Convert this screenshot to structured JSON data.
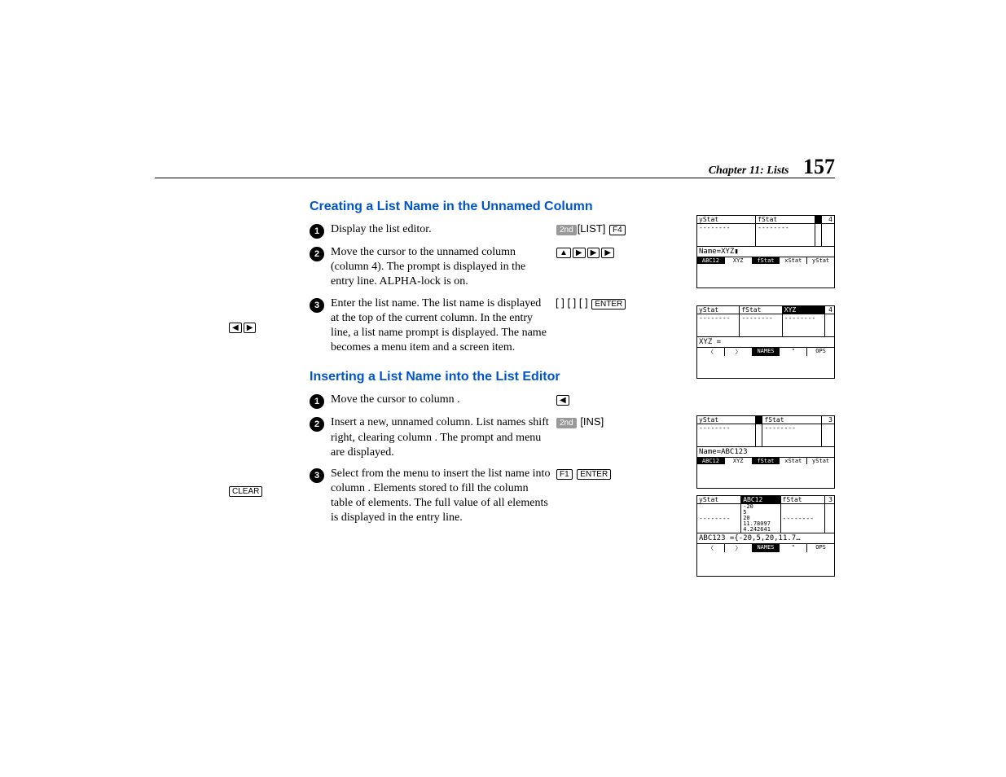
{
  "header": {
    "chapter": "Chapter 11: Lists",
    "page": "157"
  },
  "section_a": {
    "heading": "Creating a List Name in the Unnamed Column",
    "steps": [
      {
        "num": "1",
        "text": "Display the list editor.",
        "keys": [
          {
            "label": "2nd",
            "cls": "gray"
          },
          {
            "label": "[LIST]",
            "cls": "plain"
          },
          {
            "label": "F4",
            "cls": ""
          }
        ]
      },
      {
        "num": "2",
        "text": "Move the cursor to the unnamed column (column 4). The              prompt is displayed in the entry line. ALPHA-lock is on.",
        "keys": [
          {
            "label": "▲",
            "cls": ""
          },
          {
            "label": "▶",
            "cls": ""
          },
          {
            "label": "▶",
            "cls": ""
          },
          {
            "label": "▶",
            "cls": ""
          }
        ]
      },
      {
        "num": "3",
        "text": "Enter the list name. The list name is displayed at the top of the current column. In the entry line, a list name prompt is displayed. The name becomes a                         menu item and a                       screen item.",
        "keys": [
          {
            "label": "[  ] [  ] [  ]",
            "cls": "plain"
          },
          {
            "label": "ENTER",
            "cls": ""
          }
        ]
      }
    ],
    "margin_keys": [
      {
        "label": "◀",
        "cls": ""
      },
      {
        "label": "▶",
        "cls": ""
      }
    ]
  },
  "section_b": {
    "heading": "Inserting a List Name into the List Editor",
    "steps": [
      {
        "num": "1",
        "text": "Move the cursor to column   .",
        "keys": [
          {
            "label": "◀",
            "cls": ""
          }
        ]
      },
      {
        "num": "2",
        "text": "Insert a new, unnamed column. List names shift right, clearing column   . The              prompt and                       menu are displayed.",
        "keys": [
          {
            "label": "2nd",
            "cls": "gray"
          },
          {
            "label": "[INS]",
            "cls": "plain"
          }
        ]
      },
      {
        "num": "3",
        "text": "Select              from the                         menu to insert the list name                   into column   . Elements stored to                   fill the column table of elements. The full value of all elements is displayed in the entry line.",
        "keys": [
          {
            "label": "F1",
            "cls": ""
          },
          {
            "label": "ENTER",
            "cls": ""
          }
        ]
      }
    ],
    "margin_label": "CLEAR"
  },
  "screens": {
    "s1": {
      "cols": [
        "yStat",
        "fStat",
        "",
        "4"
      ],
      "dashes": [
        "--------",
        "--------",
        "",
        ""
      ],
      "name_line": "Name=XYZ▮",
      "footer": [
        "ABC12",
        "XYZ",
        "fStat",
        "xStat",
        "yStat"
      ]
    },
    "s2": {
      "cols": [
        "yStat",
        "fStat",
        "XYZ",
        "4"
      ],
      "dashes": [
        "--------",
        "--------",
        "--------",
        ""
      ],
      "name_line": "XYZ =",
      "footer": [
        "〈",
        "〉",
        "NAMES",
        "\"",
        "OPS"
      ]
    },
    "s3": {
      "cols": [
        "yStat",
        "",
        "fStat",
        "3"
      ],
      "dashes": [
        "--------",
        "",
        "--------",
        ""
      ],
      "name_line": "Name=ABC123",
      "footer": [
        "ABC12",
        "XYZ",
        "fStat",
        "xStat",
        "yStat"
      ]
    },
    "s4": {
      "cols": [
        "yStat",
        "ABC12",
        "fStat",
        "3"
      ],
      "vals": [
        "",
        "-20\n5\n20\n11.78097\n4.242641",
        "",
        ""
      ],
      "name_line": "ABC123 ={-20,5,20,11.7…",
      "footer": [
        "〈",
        "〉",
        "NAMES",
        "\"",
        "OPS"
      ]
    }
  }
}
